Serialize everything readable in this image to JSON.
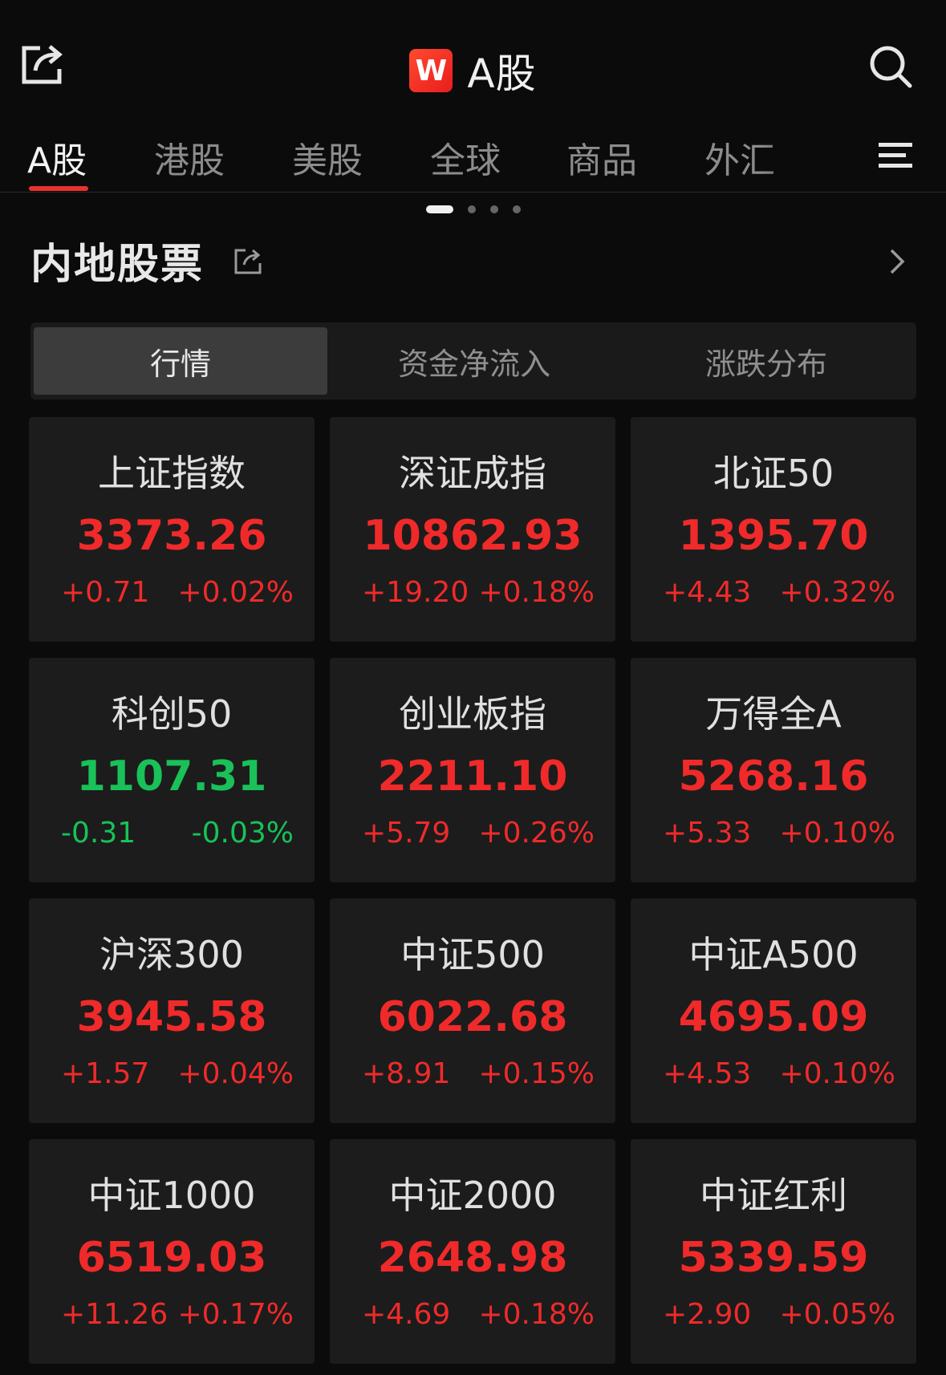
{
  "header": {
    "logo_letter": "W",
    "title": "A股"
  },
  "tabs": [
    {
      "label": "A股",
      "active": true
    },
    {
      "label": "港股",
      "active": false
    },
    {
      "label": "美股",
      "active": false
    },
    {
      "label": "全球",
      "active": false
    },
    {
      "label": "商品",
      "active": false
    },
    {
      "label": "外汇",
      "active": false
    }
  ],
  "pager": {
    "count": 4,
    "active_index": 0
  },
  "section": {
    "title": "内地股票"
  },
  "segments": [
    {
      "label": "行情",
      "active": true
    },
    {
      "label": "资金净流入",
      "active": false
    },
    {
      "label": "涨跌分布",
      "active": false
    }
  ],
  "colors": {
    "up": "#f02a2a",
    "down": "#19c158",
    "accent": "#e8312f"
  },
  "indices": [
    {
      "name": "上证指数",
      "value": "3373.26",
      "change": "+0.71",
      "pct": "+0.02%",
      "dir": "up"
    },
    {
      "name": "深证成指",
      "value": "10862.93",
      "change": "+19.20",
      "pct": "+0.18%",
      "dir": "up"
    },
    {
      "name": "北证50",
      "value": "1395.70",
      "change": "+4.43",
      "pct": "+0.32%",
      "dir": "up"
    },
    {
      "name": "科创50",
      "value": "1107.31",
      "change": "-0.31",
      "pct": "-0.03%",
      "dir": "down"
    },
    {
      "name": "创业板指",
      "value": "2211.10",
      "change": "+5.79",
      "pct": "+0.26%",
      "dir": "up"
    },
    {
      "name": "万得全A",
      "value": "5268.16",
      "change": "+5.33",
      "pct": "+0.10%",
      "dir": "up"
    },
    {
      "name": "沪深300",
      "value": "3945.58",
      "change": "+1.57",
      "pct": "+0.04%",
      "dir": "up"
    },
    {
      "name": "中证500",
      "value": "6022.68",
      "change": "+8.91",
      "pct": "+0.15%",
      "dir": "up"
    },
    {
      "name": "中证A500",
      "value": "4695.09",
      "change": "+4.53",
      "pct": "+0.10%",
      "dir": "up"
    },
    {
      "name": "中证1000",
      "value": "6519.03",
      "change": "+11.26",
      "pct": "+0.17%",
      "dir": "up"
    },
    {
      "name": "中证2000",
      "value": "2648.98",
      "change": "+4.69",
      "pct": "+0.18%",
      "dir": "up"
    },
    {
      "name": "中证红利",
      "value": "5339.59",
      "change": "+2.90",
      "pct": "+0.05%",
      "dir": "up"
    }
  ]
}
